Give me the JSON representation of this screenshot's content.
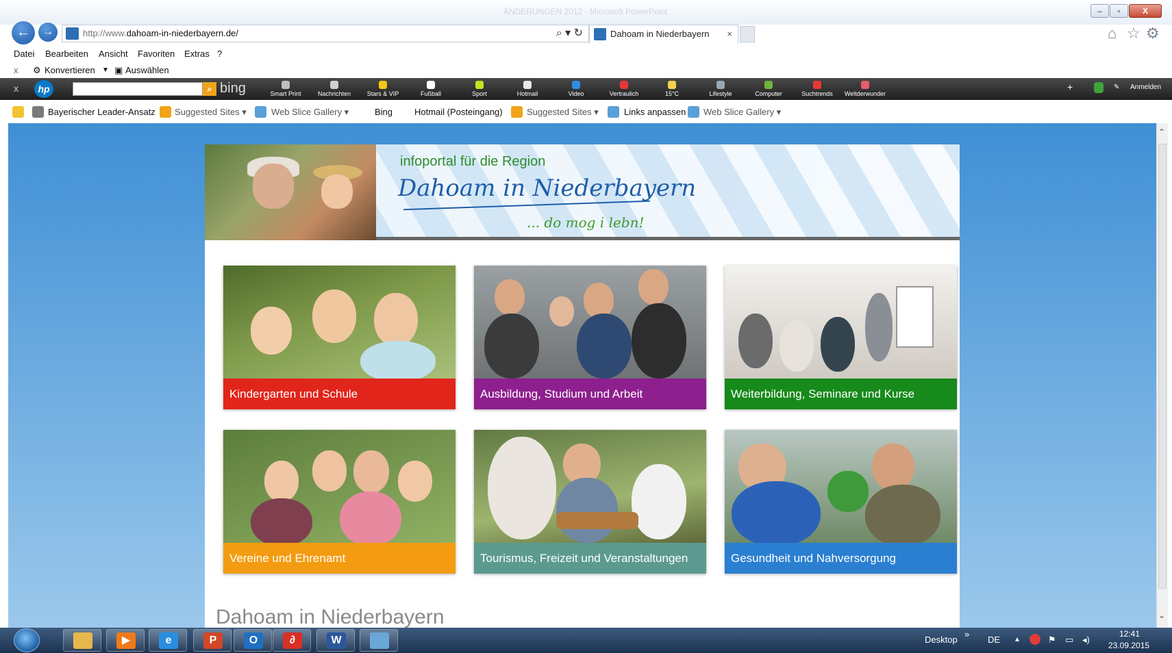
{
  "browser": {
    "ghost_title": "ÄNDERUNGEN 2012 - Microsoft PowerPoint",
    "url_prefix": "http://www.",
    "url_domain": "dahoam-in-niederbayern.de/",
    "tab_title": "Dahoam in Niederbayern",
    "tab_close": "×"
  },
  "menu": [
    "Datei",
    "Bearbeiten",
    "Ansicht",
    "Favoriten",
    "Extras",
    "?"
  ],
  "commandbar": {
    "close": "x",
    "convert": "Konvertieren",
    "select": "Auswählen"
  },
  "hp_toolbar": {
    "close": "x",
    "logo": "hp",
    "bing": "bing",
    "items": [
      {
        "label": "Smart Print",
        "color": "#bfbfbf"
      },
      {
        "label": "Nachrichten",
        "color": "#d0d0d0"
      },
      {
        "label": "Stars & VIP",
        "color": "#f5c518"
      },
      {
        "label": "Fußball",
        "color": "#ffffff"
      },
      {
        "label": "Sport",
        "color": "#c6e221"
      },
      {
        "label": "Hotmail",
        "color": "#e8e8e8"
      },
      {
        "label": "Video",
        "color": "#2f8ee0"
      },
      {
        "label": "Vertraulich",
        "color": "#e53935"
      },
      {
        "label": "15°C",
        "color": "#f6d04d"
      },
      {
        "label": "Lifestyle",
        "color": "#9aa7b4"
      },
      {
        "label": "Computer",
        "color": "#6fb33f"
      },
      {
        "label": "Suchtrends",
        "color": "#e53935"
      },
      {
        "label": "Weltderwunder",
        "color": "#e35d6a"
      }
    ],
    "plus": "+",
    "signin": "Anmelden"
  },
  "favorites": {
    "items": [
      {
        "label": "Bayerischer Leader-Ansatz"
      },
      {
        "label": "Suggested Sites ▾"
      },
      {
        "label": "Web Slice Gallery ▾"
      },
      {
        "label": "Bing"
      },
      {
        "label": "Hotmail (Posteingang)"
      },
      {
        "label": "Suggested Sites ▾"
      },
      {
        "label": "Links anpassen"
      },
      {
        "label": "Web Slice Gallery ▾"
      }
    ]
  },
  "site": {
    "tagline": "infoportal für die Region",
    "brand": "Dahoam in Niederbayern",
    "slogan": "... do mog i lebn!",
    "tiles": [
      {
        "label": "Kindergarten und Schule",
        "color": "#e1251b"
      },
      {
        "label": "Ausbildung, Studium und Arbeit",
        "color": "#8e1f8e"
      },
      {
        "label": "Weiterbildung, Seminare und Kurse",
        "color": "#168a1a"
      },
      {
        "label": "Vereine und Ehrenamt",
        "color": "#f39c12"
      },
      {
        "label": "Tourismus, Freizeit und Veranstaltungen",
        "color": "#5c9a8f"
      },
      {
        "label": "Gesundheit und Nahversorgung",
        "color": "#2a7fd1"
      }
    ],
    "section_heading": "Dahoam in Niederbayern"
  },
  "taskbar": {
    "apps": [
      {
        "name": "explorer",
        "glyph": "",
        "color": "#e8b74b"
      },
      {
        "name": "media-player",
        "glyph": "▶",
        "color": "#f07a1a"
      },
      {
        "name": "internet-explorer",
        "glyph": "e",
        "color": "#2a8ee0"
      },
      {
        "name": "powerpoint",
        "glyph": "P",
        "color": "#d24726"
      },
      {
        "name": "outlook",
        "glyph": "O",
        "color": "#1f6fc2"
      },
      {
        "name": "acrobat",
        "glyph": "∂",
        "color": "#d93025"
      },
      {
        "name": "word",
        "glyph": "W",
        "color": "#2b579a"
      },
      {
        "name": "image-viewer",
        "glyph": "",
        "color": "#6aa6d8"
      }
    ],
    "desktop": "Desktop",
    "chevron": "»",
    "lang": "DE",
    "time": "12:41",
    "date": "23.09.2015"
  }
}
